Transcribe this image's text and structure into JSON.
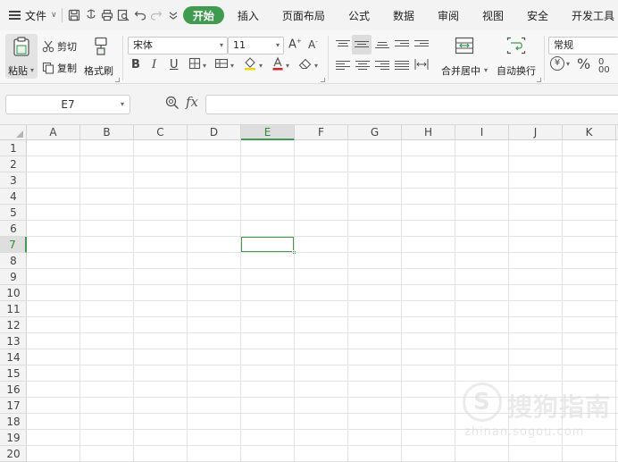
{
  "menu": {
    "file_label": "文件",
    "tabs": [
      {
        "label": "开始",
        "active": true
      },
      {
        "label": "插入",
        "active": false
      },
      {
        "label": "页面布局",
        "active": false
      },
      {
        "label": "公式",
        "active": false
      },
      {
        "label": "数据",
        "active": false
      },
      {
        "label": "审阅",
        "active": false
      },
      {
        "label": "视图",
        "active": false
      },
      {
        "label": "安全",
        "active": false
      },
      {
        "label": "开发工具",
        "active": false
      }
    ],
    "quick_icons": [
      "save-icon",
      "export-icon",
      "print-icon",
      "print-preview-icon",
      "undo-icon",
      "redo-icon",
      "customize-icon"
    ]
  },
  "ribbon": {
    "paste_label": "粘贴",
    "cut_label": "剪切",
    "copy_label": "复制",
    "format_painter_label": "格式刷",
    "font_name": "宋体",
    "font_size": "11",
    "merge_center_label": "合并居中",
    "wrap_text_label": "自动换行",
    "number_format": "常规",
    "currency_symbol": "¥",
    "percent_symbol": "%"
  },
  "formula_bar": {
    "name_box": "E7",
    "fx_label": "fx",
    "formula": ""
  },
  "grid": {
    "columns": [
      "A",
      "B",
      "C",
      "D",
      "E",
      "F",
      "G",
      "H",
      "I",
      "J",
      "K"
    ],
    "rows": [
      "1",
      "2",
      "3",
      "4",
      "5",
      "6",
      "7",
      "8",
      "9",
      "10",
      "11",
      "12",
      "13",
      "14",
      "15",
      "16",
      "17",
      "18",
      "19",
      "20"
    ],
    "selected_column": "E",
    "selected_row": "7"
  },
  "watermark": {
    "brand": "搜狗指南",
    "url": "zhinan.sogou.com"
  },
  "colors": {
    "accent": "#3e9c4e",
    "menubar_bg": "#f3f3f3",
    "ribbon_bg": "#f7f7f7"
  }
}
